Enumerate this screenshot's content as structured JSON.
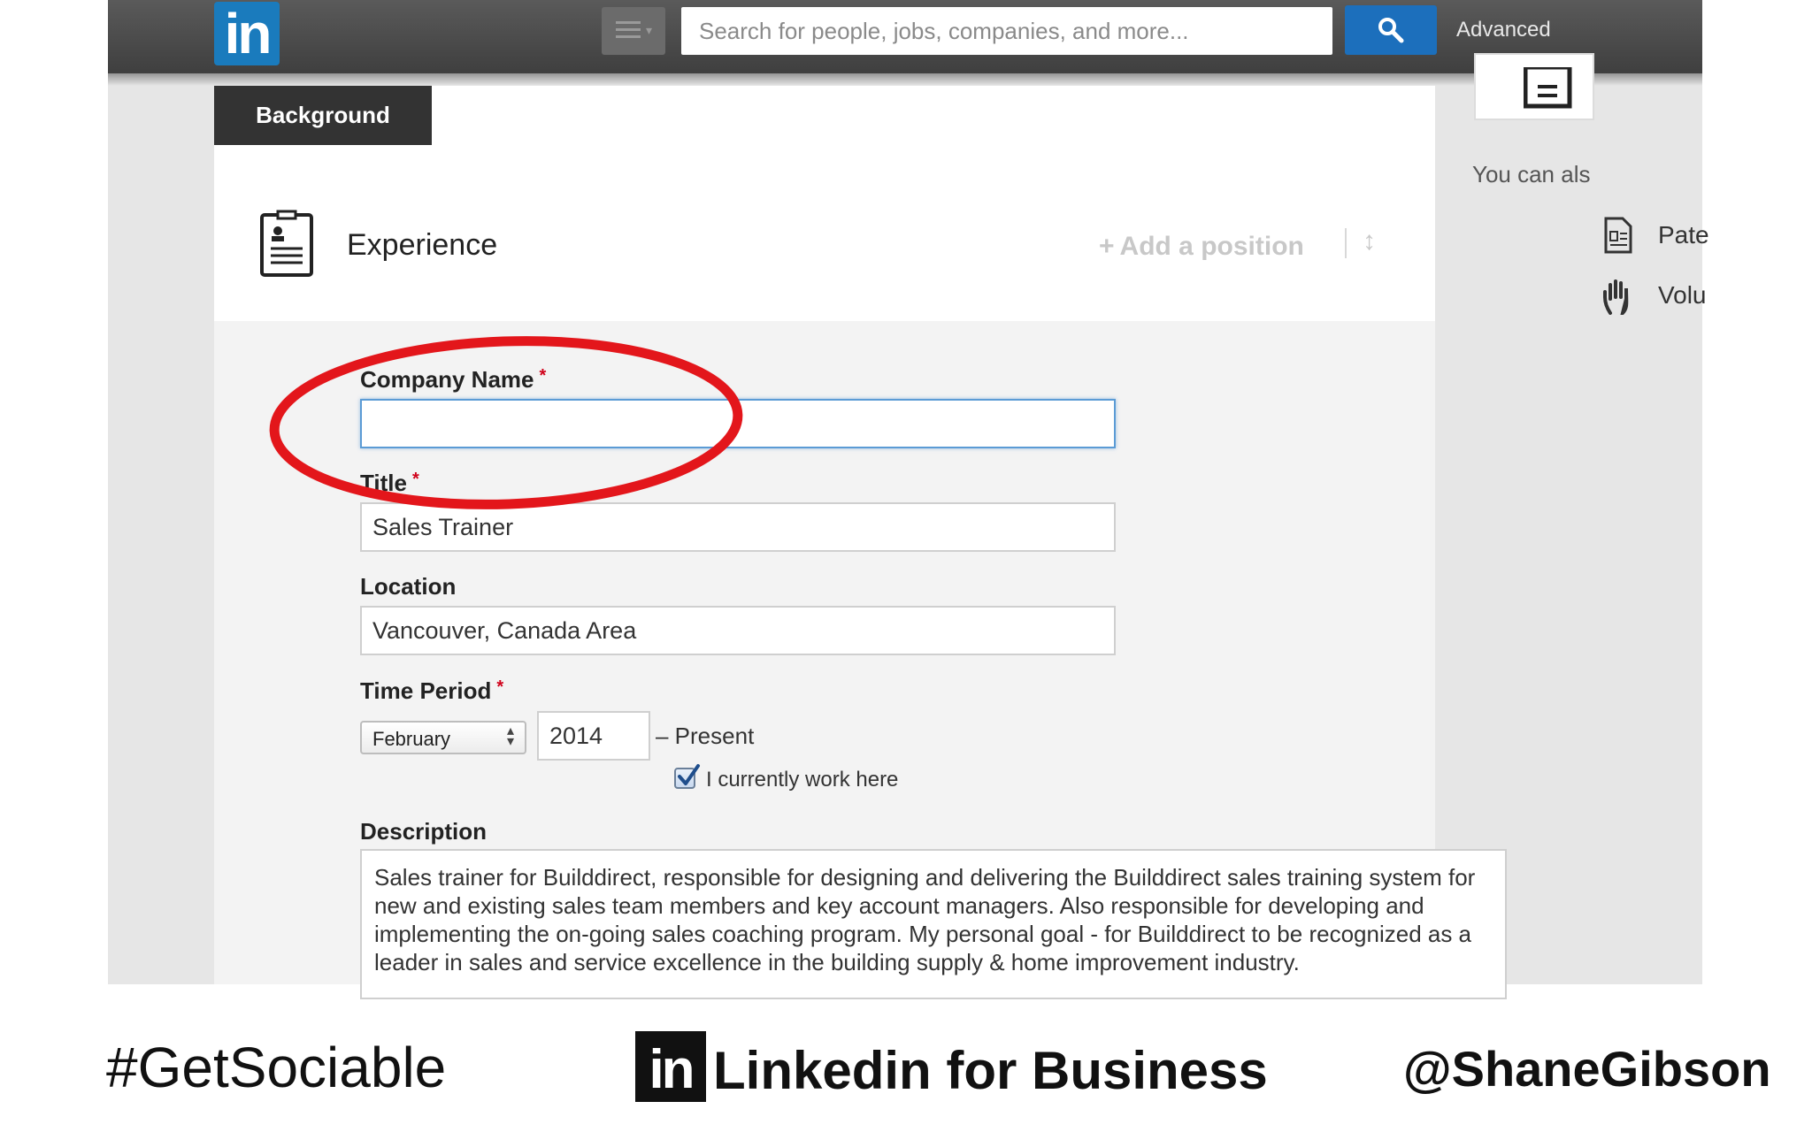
{
  "topbar": {
    "logo_text": "in",
    "search_placeholder": "Search for people, jobs, companies, and more...",
    "advanced_label": "Advanced"
  },
  "section": {
    "tab_label": "Background",
    "title": "Experience",
    "add_position_label": "Add a position"
  },
  "form": {
    "company_label": "Company Name",
    "company_value": "",
    "title_label": "Title",
    "title_value": "Sales Trainer",
    "location_label": "Location",
    "location_value": "Vancouver, Canada Area",
    "time_period_label": "Time Period",
    "month_selected": "February",
    "year_value": "2014",
    "present_label": "– Present",
    "current_work_label": "I currently work here",
    "current_work_checked": true,
    "description_label": "Description",
    "description_value": "Sales trainer for Builddirect, responsible for designing and delivering the Builddirect sales training system for new and existing sales team members and key account managers. Also responsible for developing and implementing the on-going sales coaching program. My personal goal - for Builddirect to be recognized as a leader in sales and service excellence in the building supply & home improvement industry.",
    "required_marker": "*"
  },
  "sidebar": {
    "hint": "You can als",
    "items": [
      "Pate",
      "Volu"
    ]
  },
  "footer": {
    "hashtag": "#GetSociable",
    "logo_text": "in",
    "title": "Linkedin for Business",
    "handle": "@ShaneGibson"
  },
  "colors": {
    "linkedin_blue": "#1a7bbd",
    "search_button": "#1c6fbc",
    "highlight_ellipse": "#e3161b",
    "required": "#d0021b"
  }
}
